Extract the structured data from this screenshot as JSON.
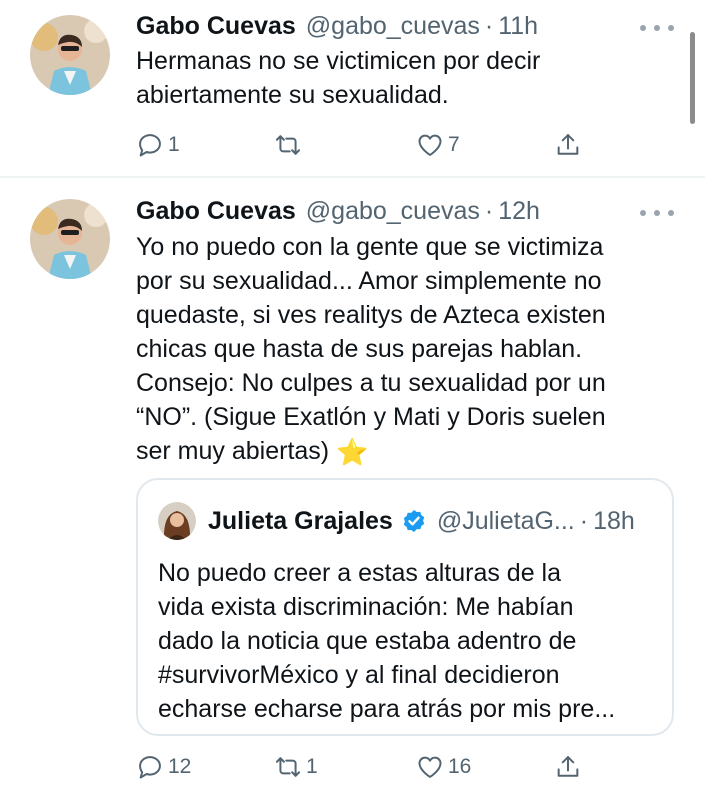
{
  "tweets": [
    {
      "author_name": "Gabo Cuevas",
      "author_handle": "@gabo_cuevas",
      "separator": "·",
      "time": "11h",
      "text_lines": [
        "Hermanas no se victimicen por decir",
        "abiertamente su sexualidad."
      ],
      "replies": "1",
      "retweets": "",
      "likes": "7"
    },
    {
      "author_name": "Gabo Cuevas",
      "author_handle": "@gabo_cuevas",
      "separator": "·",
      "time": "12h",
      "text_lines": [
        "Yo no puedo con la gente que se victimiza",
        "por su sexualidad... Amor simplemente no",
        "quedaste, si ves realitys de Azteca existen",
        "chicas que hasta de sus parejas hablan.",
        "Consejo: No culpes a tu sexualidad por un",
        "“NO”.  (Sigue Exatlón y Mati y Doris suelen",
        "ser muy abiertas)"
      ],
      "emoji": "⭐",
      "quoted": {
        "author_name": "Julieta Grajales",
        "author_handle": "@JulietaG...",
        "separator": "·",
        "time": "18h",
        "text_lines": [
          "No puedo creer a estas alturas de la",
          "vida exista discriminación: Me habían",
          "dado la noticia que estaba adentro de",
          "#survivorMéxico y al final decidieron",
          "echarse echarse para atrás por mis pre..."
        ]
      },
      "replies": "12",
      "retweets": "1",
      "likes": "16"
    }
  ],
  "icons": {
    "reply": "reply-icon",
    "retweet": "retweet-icon",
    "like": "heart-icon",
    "share": "share-icon",
    "more": "more-icon",
    "verified": "verified-badge-icon"
  },
  "colors": {
    "text": "#0f1419",
    "secondary": "#536471",
    "verified": "#1d9bf0",
    "border": "#e1e8ed"
  }
}
